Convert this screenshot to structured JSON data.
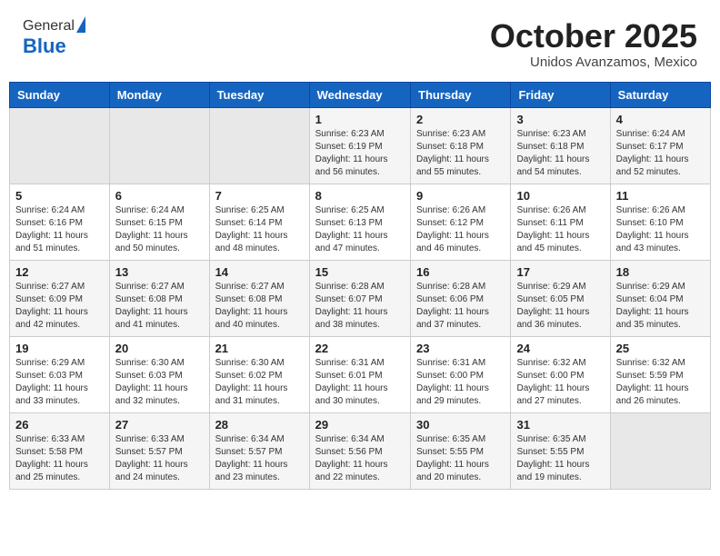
{
  "header": {
    "logo_line1": "General",
    "logo_line2": "Blue",
    "month": "October 2025",
    "location": "Unidos Avanzamos, Mexico"
  },
  "weekdays": [
    "Sunday",
    "Monday",
    "Tuesday",
    "Wednesday",
    "Thursday",
    "Friday",
    "Saturday"
  ],
  "weeks": [
    [
      {
        "day": "",
        "content": ""
      },
      {
        "day": "",
        "content": ""
      },
      {
        "day": "",
        "content": ""
      },
      {
        "day": "1",
        "content": "Sunrise: 6:23 AM\nSunset: 6:19 PM\nDaylight: 11 hours\nand 56 minutes."
      },
      {
        "day": "2",
        "content": "Sunrise: 6:23 AM\nSunset: 6:18 PM\nDaylight: 11 hours\nand 55 minutes."
      },
      {
        "day": "3",
        "content": "Sunrise: 6:23 AM\nSunset: 6:18 PM\nDaylight: 11 hours\nand 54 minutes."
      },
      {
        "day": "4",
        "content": "Sunrise: 6:24 AM\nSunset: 6:17 PM\nDaylight: 11 hours\nand 52 minutes."
      }
    ],
    [
      {
        "day": "5",
        "content": "Sunrise: 6:24 AM\nSunset: 6:16 PM\nDaylight: 11 hours\nand 51 minutes."
      },
      {
        "day": "6",
        "content": "Sunrise: 6:24 AM\nSunset: 6:15 PM\nDaylight: 11 hours\nand 50 minutes."
      },
      {
        "day": "7",
        "content": "Sunrise: 6:25 AM\nSunset: 6:14 PM\nDaylight: 11 hours\nand 48 minutes."
      },
      {
        "day": "8",
        "content": "Sunrise: 6:25 AM\nSunset: 6:13 PM\nDaylight: 11 hours\nand 47 minutes."
      },
      {
        "day": "9",
        "content": "Sunrise: 6:26 AM\nSunset: 6:12 PM\nDaylight: 11 hours\nand 46 minutes."
      },
      {
        "day": "10",
        "content": "Sunrise: 6:26 AM\nSunset: 6:11 PM\nDaylight: 11 hours\nand 45 minutes."
      },
      {
        "day": "11",
        "content": "Sunrise: 6:26 AM\nSunset: 6:10 PM\nDaylight: 11 hours\nand 43 minutes."
      }
    ],
    [
      {
        "day": "12",
        "content": "Sunrise: 6:27 AM\nSunset: 6:09 PM\nDaylight: 11 hours\nand 42 minutes."
      },
      {
        "day": "13",
        "content": "Sunrise: 6:27 AM\nSunset: 6:08 PM\nDaylight: 11 hours\nand 41 minutes."
      },
      {
        "day": "14",
        "content": "Sunrise: 6:27 AM\nSunset: 6:08 PM\nDaylight: 11 hours\nand 40 minutes."
      },
      {
        "day": "15",
        "content": "Sunrise: 6:28 AM\nSunset: 6:07 PM\nDaylight: 11 hours\nand 38 minutes."
      },
      {
        "day": "16",
        "content": "Sunrise: 6:28 AM\nSunset: 6:06 PM\nDaylight: 11 hours\nand 37 minutes."
      },
      {
        "day": "17",
        "content": "Sunrise: 6:29 AM\nSunset: 6:05 PM\nDaylight: 11 hours\nand 36 minutes."
      },
      {
        "day": "18",
        "content": "Sunrise: 6:29 AM\nSunset: 6:04 PM\nDaylight: 11 hours\nand 35 minutes."
      }
    ],
    [
      {
        "day": "19",
        "content": "Sunrise: 6:29 AM\nSunset: 6:03 PM\nDaylight: 11 hours\nand 33 minutes."
      },
      {
        "day": "20",
        "content": "Sunrise: 6:30 AM\nSunset: 6:03 PM\nDaylight: 11 hours\nand 32 minutes."
      },
      {
        "day": "21",
        "content": "Sunrise: 6:30 AM\nSunset: 6:02 PM\nDaylight: 11 hours\nand 31 minutes."
      },
      {
        "day": "22",
        "content": "Sunrise: 6:31 AM\nSunset: 6:01 PM\nDaylight: 11 hours\nand 30 minutes."
      },
      {
        "day": "23",
        "content": "Sunrise: 6:31 AM\nSunset: 6:00 PM\nDaylight: 11 hours\nand 29 minutes."
      },
      {
        "day": "24",
        "content": "Sunrise: 6:32 AM\nSunset: 6:00 PM\nDaylight: 11 hours\nand 27 minutes."
      },
      {
        "day": "25",
        "content": "Sunrise: 6:32 AM\nSunset: 5:59 PM\nDaylight: 11 hours\nand 26 minutes."
      }
    ],
    [
      {
        "day": "26",
        "content": "Sunrise: 6:33 AM\nSunset: 5:58 PM\nDaylight: 11 hours\nand 25 minutes."
      },
      {
        "day": "27",
        "content": "Sunrise: 6:33 AM\nSunset: 5:57 PM\nDaylight: 11 hours\nand 24 minutes."
      },
      {
        "day": "28",
        "content": "Sunrise: 6:34 AM\nSunset: 5:57 PM\nDaylight: 11 hours\nand 23 minutes."
      },
      {
        "day": "29",
        "content": "Sunrise: 6:34 AM\nSunset: 5:56 PM\nDaylight: 11 hours\nand 22 minutes."
      },
      {
        "day": "30",
        "content": "Sunrise: 6:35 AM\nSunset: 5:55 PM\nDaylight: 11 hours\nand 20 minutes."
      },
      {
        "day": "31",
        "content": "Sunrise: 6:35 AM\nSunset: 5:55 PM\nDaylight: 11 hours\nand 19 minutes."
      },
      {
        "day": "",
        "content": ""
      }
    ]
  ]
}
